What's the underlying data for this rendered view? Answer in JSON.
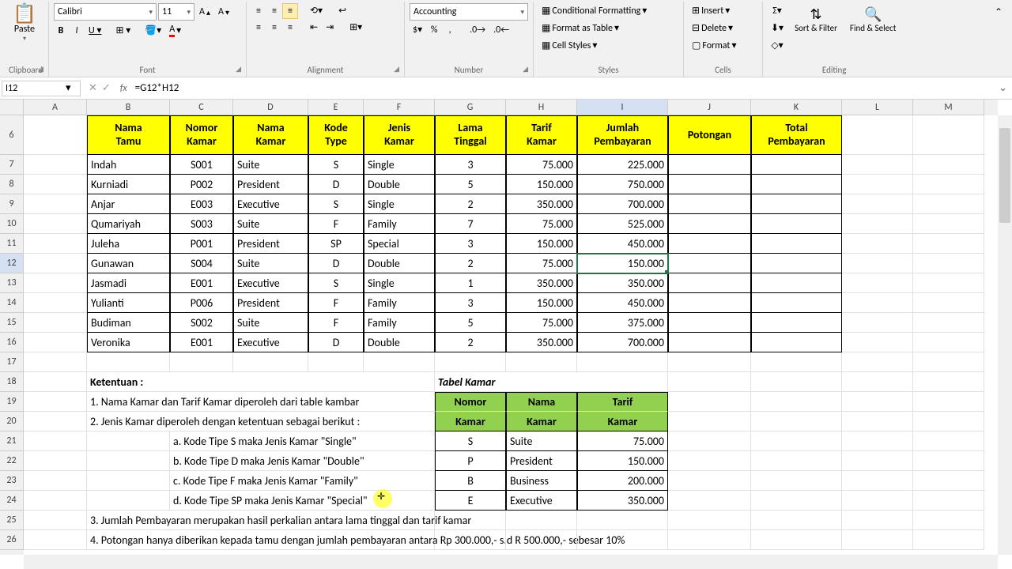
{
  "ribbon": {
    "font_name": "Calibri",
    "font_size": "11",
    "number_format": "Accounting",
    "clipboard": {
      "paste": "Paste",
      "label": "Clipboard"
    },
    "font": {
      "label": "Font"
    },
    "alignment": {
      "label": "Alignment"
    },
    "number": {
      "label": "Number"
    },
    "styles": {
      "cond": "Conditional Formatting",
      "table": "Format as Table",
      "cell": "Cell Styles",
      "label": "Styles"
    },
    "cells": {
      "insert": "Insert",
      "delete": "Delete",
      "format": "Format",
      "label": "Cells"
    },
    "editing": {
      "sort": "Sort & Filter",
      "find": "Find & Select",
      "label": "Editing"
    }
  },
  "formula_bar": {
    "name_box": "I12",
    "formula": "=G12*H12"
  },
  "columns": [
    {
      "l": "A",
      "w": 80
    },
    {
      "l": "B",
      "w": 105
    },
    {
      "l": "C",
      "w": 80
    },
    {
      "l": "D",
      "w": 95
    },
    {
      "l": "E",
      "w": 70
    },
    {
      "l": "F",
      "w": 90
    },
    {
      "l": "G",
      "w": 90
    },
    {
      "l": "H",
      "w": 90
    },
    {
      "l": "I",
      "w": 115
    },
    {
      "l": "J",
      "w": 105
    },
    {
      "l": "K",
      "w": 115
    },
    {
      "l": "L",
      "w": 90
    },
    {
      "l": "M",
      "w": 90
    }
  ],
  "rows_start": 6,
  "main_table": {
    "headers": [
      "Nama Tamu",
      "Nomor Kamar",
      "Nama Kamar",
      "Kode Type",
      "Jenis Kamar",
      "Lama Tinggal",
      "Tarif Kamar",
      "Jumlah Pembayaran",
      "Potongan",
      "Total Pembayaran"
    ],
    "rows": [
      [
        "Indah",
        "S001",
        "Suite",
        "S",
        "Single",
        "3",
        "75.000",
        "225.000",
        "",
        ""
      ],
      [
        "Kurniadi",
        "P002",
        "President",
        "D",
        "Double",
        "5",
        "150.000",
        "750.000",
        "",
        ""
      ],
      [
        "Anjar",
        "E003",
        "Executive",
        "S",
        "Single",
        "2",
        "350.000",
        "700.000",
        "",
        ""
      ],
      [
        "Qumariyah",
        "S003",
        "Suite",
        "F",
        "Family",
        "7",
        "75.000",
        "525.000",
        "",
        ""
      ],
      [
        "Juleha",
        "P001",
        "President",
        "SP",
        "Special",
        "3",
        "150.000",
        "450.000",
        "",
        ""
      ],
      [
        "Gunawan",
        "S004",
        "Suite",
        "D",
        "Double",
        "2",
        "75.000",
        "150.000",
        "",
        ""
      ],
      [
        "Jasmadi",
        "E001",
        "Executive",
        "S",
        "Single",
        "1",
        "350.000",
        "350.000",
        "",
        ""
      ],
      [
        "Yulianti",
        "P006",
        "President",
        "F",
        "Family",
        "3",
        "150.000",
        "450.000",
        "",
        ""
      ],
      [
        "Budiman",
        "S002",
        "Suite",
        "F",
        "Family",
        "5",
        "75.000",
        "375.000",
        "",
        ""
      ],
      [
        "Veronika",
        "E001",
        "Executive",
        "D",
        "Double",
        "2",
        "350.000",
        "700.000",
        "",
        ""
      ]
    ]
  },
  "ketentuan": {
    "title": "Ketentuan :",
    "lines": [
      "1. Nama Kamar dan Tarif Kamar diperoleh dari table kambar",
      "2. Jenis Kamar diperoleh dengan ketentuan sebagai berikut :",
      "a. Kode Tipe S maka Jenis Kamar \"Single\"",
      "b. Kode Tipe D maka Jenis Kamar \"Double\"",
      "c. Kode Tipe F maka Jenis Kamar \"Family\"",
      "d. Kode Tipe SP maka Jenis Kamar \"Special\"",
      "3. Jumlah Pembayaran merupakan hasil perkalian antara lama tinggal dan tarif kamar",
      "4. Potongan hanya diberikan kepada tamu dengan jumlah pembayaran antara Rp 300.000,- s.d R 500.000,- sebesar 10%"
    ]
  },
  "tabel_kamar": {
    "title": "Tabel Kamar",
    "headers": [
      "Nomor Kamar",
      "Nama Kamar",
      "Tarif Kamar"
    ],
    "rows": [
      [
        "S",
        "Suite",
        "75.000"
      ],
      [
        "P",
        "President",
        "150.000"
      ],
      [
        "B",
        "Business",
        "200.000"
      ],
      [
        "E",
        "Executive",
        "350.000"
      ]
    ]
  },
  "selected_cell": "I12"
}
